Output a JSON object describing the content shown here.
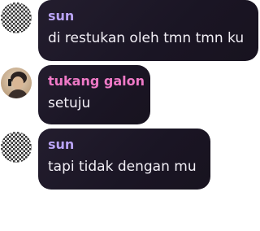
{
  "messages": [
    {
      "user": "sun",
      "user_color": "#b9a3f5",
      "avatar": "checker-pattern-avatar-icon",
      "text": "di restukan oleh tmn tmn ku"
    },
    {
      "user": "tukang galon",
      "user_color": "#ee79c6",
      "avatar": "photo-avatar",
      "text": "setuju"
    },
    {
      "user": "sun",
      "user_color": "#b9a3f5",
      "avatar": "checker-pattern-avatar-icon",
      "text": "tapi tidak dengan mu"
    }
  ]
}
